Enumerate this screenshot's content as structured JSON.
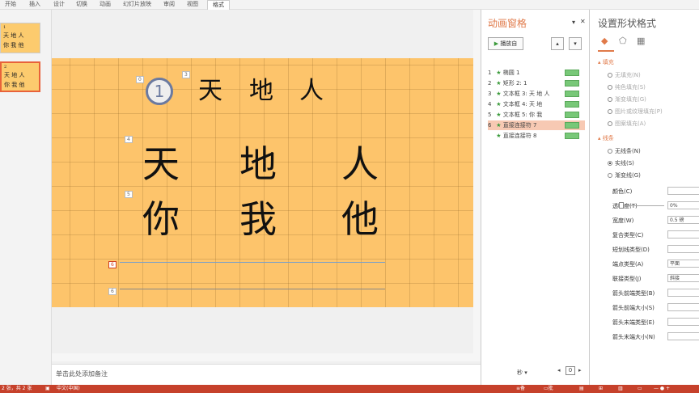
{
  "ribbon": {
    "tabs": [
      "开始",
      "插入",
      "设计",
      "切换",
      "动画",
      "幻灯片放映",
      "审阅",
      "视图",
      "格式"
    ],
    "active": "格式"
  },
  "thumbnails": [
    {
      "label": "1",
      "lines": [
        "天  地  人",
        "你  我  他"
      ]
    },
    {
      "label": "2",
      "lines": [
        "天  地  人",
        "你 我 他"
      ]
    }
  ],
  "slide": {
    "row_small": [
      "天",
      "地",
      "人"
    ],
    "row_big1": [
      "天",
      "地",
      "人"
    ],
    "row_big2": [
      "你",
      "我",
      "他"
    ],
    "anim_number": "1",
    "tags": {
      "t0": "0",
      "t3": "3",
      "t4": "4",
      "t5": "5",
      "t6a": "6",
      "t6b": "6"
    }
  },
  "notes": {
    "placeholder": "单击此处添加备注"
  },
  "animation_pane": {
    "title": "动画窗格",
    "play_label": "播放自",
    "items": [
      {
        "num": "1",
        "label": "椭圆 1"
      },
      {
        "num": "2",
        "label": "矩形 2: 1"
      },
      {
        "num": "3",
        "label": "文本框 3: 天   地   人"
      },
      {
        "num": "4",
        "label": "文本框 4: 天     地"
      },
      {
        "num": "5",
        "label": "文本框 5: 你     我"
      },
      {
        "num": "6",
        "label": "直接连接符 7"
      },
      {
        "num": "",
        "label": "直接连接符 8"
      }
    ],
    "selected_index": 5,
    "seconds_label": "秒 ▾",
    "zoom_value": "0"
  },
  "format_pane": {
    "title": "设置形状格式",
    "fill_section": "填充",
    "fill_options": [
      "无填充(N)",
      "纯色填充(S)",
      "渐变填充(G)",
      "图片或纹理填充(P)",
      "图案填充(A)"
    ],
    "line_section": "线条",
    "line_options": [
      "无线条(N)",
      "实线(S)",
      "渐变线(G)"
    ],
    "line_selected": 1,
    "props": [
      {
        "label": "颜色(C)",
        "value": ""
      },
      {
        "label": "透明度(T)",
        "value": "0%"
      },
      {
        "label": "宽度(W)",
        "value": "0.5 磅"
      },
      {
        "label": "复合类型(C)",
        "value": ""
      },
      {
        "label": "短划线类型(D)",
        "value": ""
      },
      {
        "label": "端点类型(A)",
        "value": "平面"
      },
      {
        "label": "联接类型(J)",
        "value": "斜接"
      },
      {
        "label": "箭头前端类型(B)",
        "value": ""
      },
      {
        "label": "箭头前端大小(S)",
        "value": ""
      },
      {
        "label": "箭头末端类型(E)",
        "value": ""
      },
      {
        "label": "箭头末端大小(N)",
        "value": ""
      }
    ]
  },
  "status": {
    "slide_info": "2 张，共 2 张",
    "language": "中文(中国)",
    "notes": "备注",
    "comments": "批注"
  }
}
